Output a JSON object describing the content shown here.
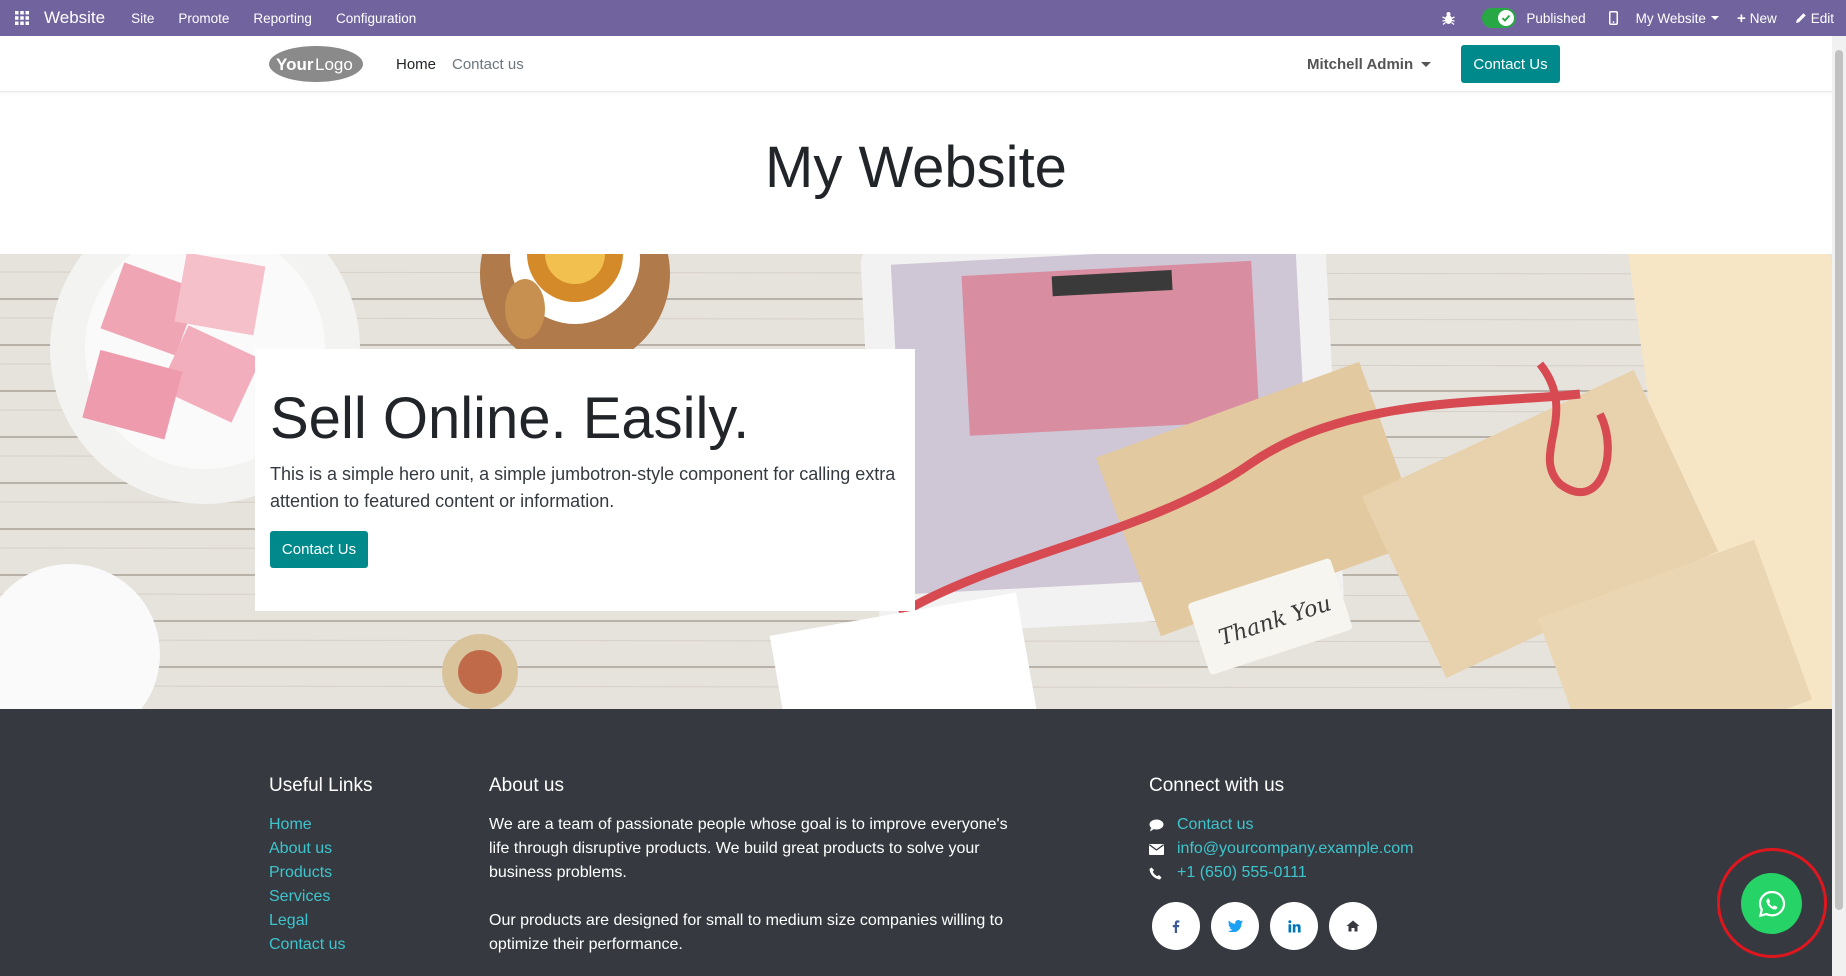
{
  "admin_bar": {
    "app_title": "Website",
    "menu": [
      "Site",
      "Promote",
      "Reporting",
      "Configuration"
    ],
    "published_label": "Published",
    "website_selector": "My Website",
    "new_label": "New",
    "edit_label": "Edit"
  },
  "header": {
    "logo_text": "YourLogo",
    "nav": [
      "Home",
      "Contact us"
    ],
    "user": "Mitchell Admin",
    "cta": "Contact Us"
  },
  "page": {
    "title": "My Website"
  },
  "hero": {
    "title": "Sell Online. Easily.",
    "text": "This is a simple hero unit, a simple jumbotron-style component for calling extra attention to featured content or information.",
    "button": "Contact Us"
  },
  "footer": {
    "useful_links": {
      "heading": "Useful Links",
      "items": [
        "Home",
        "About us",
        "Products",
        "Services",
        "Legal",
        "Contact us"
      ]
    },
    "about": {
      "heading": "About us",
      "p1": "We are a team of passionate people whose goal is to improve everyone's life through disruptive products. We build great products to solve your business problems.",
      "p2": "Our products are designed for small to medium size companies willing to optimize their performance."
    },
    "connect": {
      "heading": "Connect with us",
      "contact": "Contact us",
      "email": "info@yourcompany.example.com",
      "phone": "+1 (650) 555-0111"
    },
    "social": [
      "facebook-icon",
      "twitter-icon",
      "linkedin-icon",
      "home-icon"
    ]
  },
  "colors": {
    "admin_bar": "#71639e",
    "primary": "#00898b",
    "footer_bg": "#363a40",
    "footer_link": "#3dc5ce",
    "whatsapp": "#25d366",
    "highlight_ring": "#e0161f"
  }
}
